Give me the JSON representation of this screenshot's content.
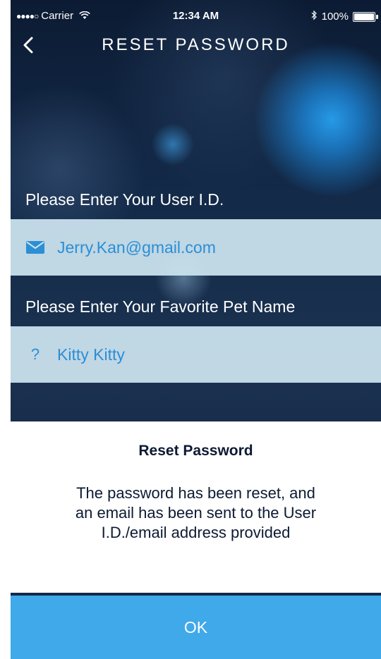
{
  "status_bar": {
    "signal": "●●●●○",
    "carrier": "Carrier",
    "time": "12:34 AM",
    "battery": "100%"
  },
  "nav": {
    "title": "RESET PASSWORD",
    "back_icon": "chevron-left-icon"
  },
  "form": {
    "user_id_label": "Please Enter Your User I.D.",
    "user_id_value": "Jerry.Kan@gmail.com",
    "user_id_icon": "envelope-icon",
    "pet_label": "Please Enter Your Favorite Pet Name",
    "pet_value": "Kitty Kitty",
    "pet_icon_glyph": "?"
  },
  "dialog": {
    "title": "Reset Password",
    "message": "The password has been reset, and an email has been sent to the User I.D./email address provided",
    "ok_label": "OK"
  },
  "colors": {
    "accent": "#3fa9ea",
    "field_text": "#2b8fd6",
    "dialog_text": "#0c1a33"
  }
}
